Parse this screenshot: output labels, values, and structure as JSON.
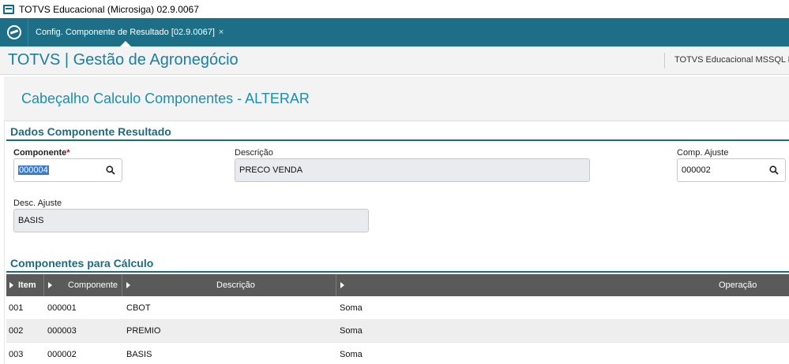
{
  "window": {
    "title": "TOTVS Educacional (Microsiga) 02.9.0067"
  },
  "tabbar": {
    "tab_label": "Config. Componente de Resultado [02.9.0067]",
    "tab_close": "×"
  },
  "header": {
    "brand": "TOTVS | Gestão de Agronegócio",
    "environment": "TOTVS Educacional MSSQL P"
  },
  "page": {
    "title": "Cabeçalho Calculo Componentes - ALTERAR"
  },
  "section_resultado": {
    "title": "Dados Componente Resultado",
    "componente": {
      "label": "Componente",
      "required_mark": "*",
      "value": "000004"
    },
    "descricao": {
      "label": "Descrição",
      "value": "PRECO VENDA"
    },
    "comp_ajuste": {
      "label": "Comp. Ajuste",
      "value": "000002"
    },
    "desc_ajuste": {
      "label": "Desc. Ajuste",
      "value": "BASIS"
    }
  },
  "section_calculo": {
    "title": "Componentes para Cálculo",
    "columns": [
      "Item",
      "Componente",
      "Descrição",
      "Operação"
    ],
    "rows": [
      {
        "item": "001",
        "componente": "000001",
        "descricao": "CBOT",
        "operacao": "Soma"
      },
      {
        "item": "002",
        "componente": "000003",
        "descricao": "PREMIO",
        "operacao": "Soma"
      },
      {
        "item": "003",
        "componente": "000002",
        "descricao": "BASIS",
        "operacao": "Soma"
      }
    ]
  },
  "colors": {
    "tabbar": "#1c6f87",
    "brand": "#1a7fa3",
    "section": "#1e6b80",
    "grid_header": "#5a5a5a"
  },
  "icons": [
    "app-window-icon",
    "totvs-logo-icon",
    "search-icon"
  ]
}
